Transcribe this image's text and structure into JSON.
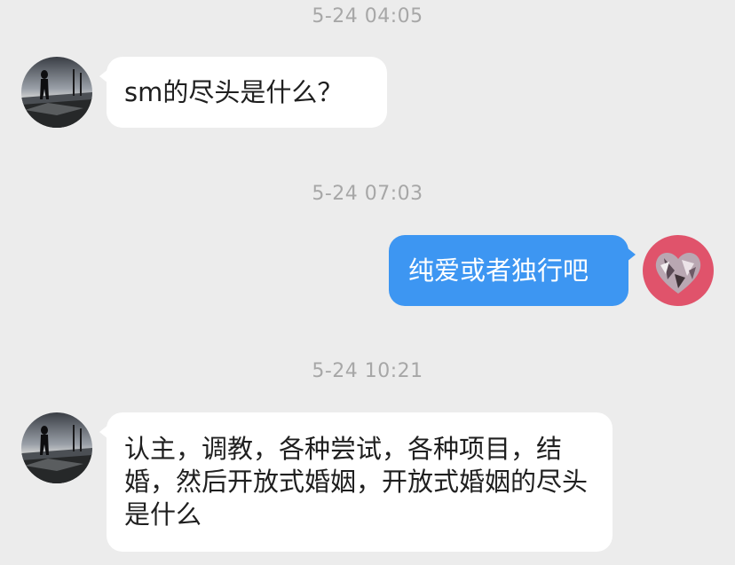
{
  "chat": {
    "messages": [
      {
        "time": "5-24 04:05",
        "sender": "other",
        "text": "sm的尽头是什么？"
      },
      {
        "time": "5-24 07:03",
        "sender": "self",
        "text": "纯爱或者独行吧"
      },
      {
        "time": "5-24 10:21",
        "sender": "other",
        "text": "认主，调教，各种尝试，各种项目，结婚，然后开放式婚姻，开放式婚姻的尽头是什么"
      }
    ]
  },
  "avatars": {
    "other": "silhouette-street-photo-avatar",
    "self": "pink-heart-avatar"
  },
  "colors": {
    "background": "#ececec",
    "incoming_bubble": "#ffffff",
    "outgoing_bubble": "#3d96f2",
    "timestamp_text": "#a7a7a7"
  }
}
